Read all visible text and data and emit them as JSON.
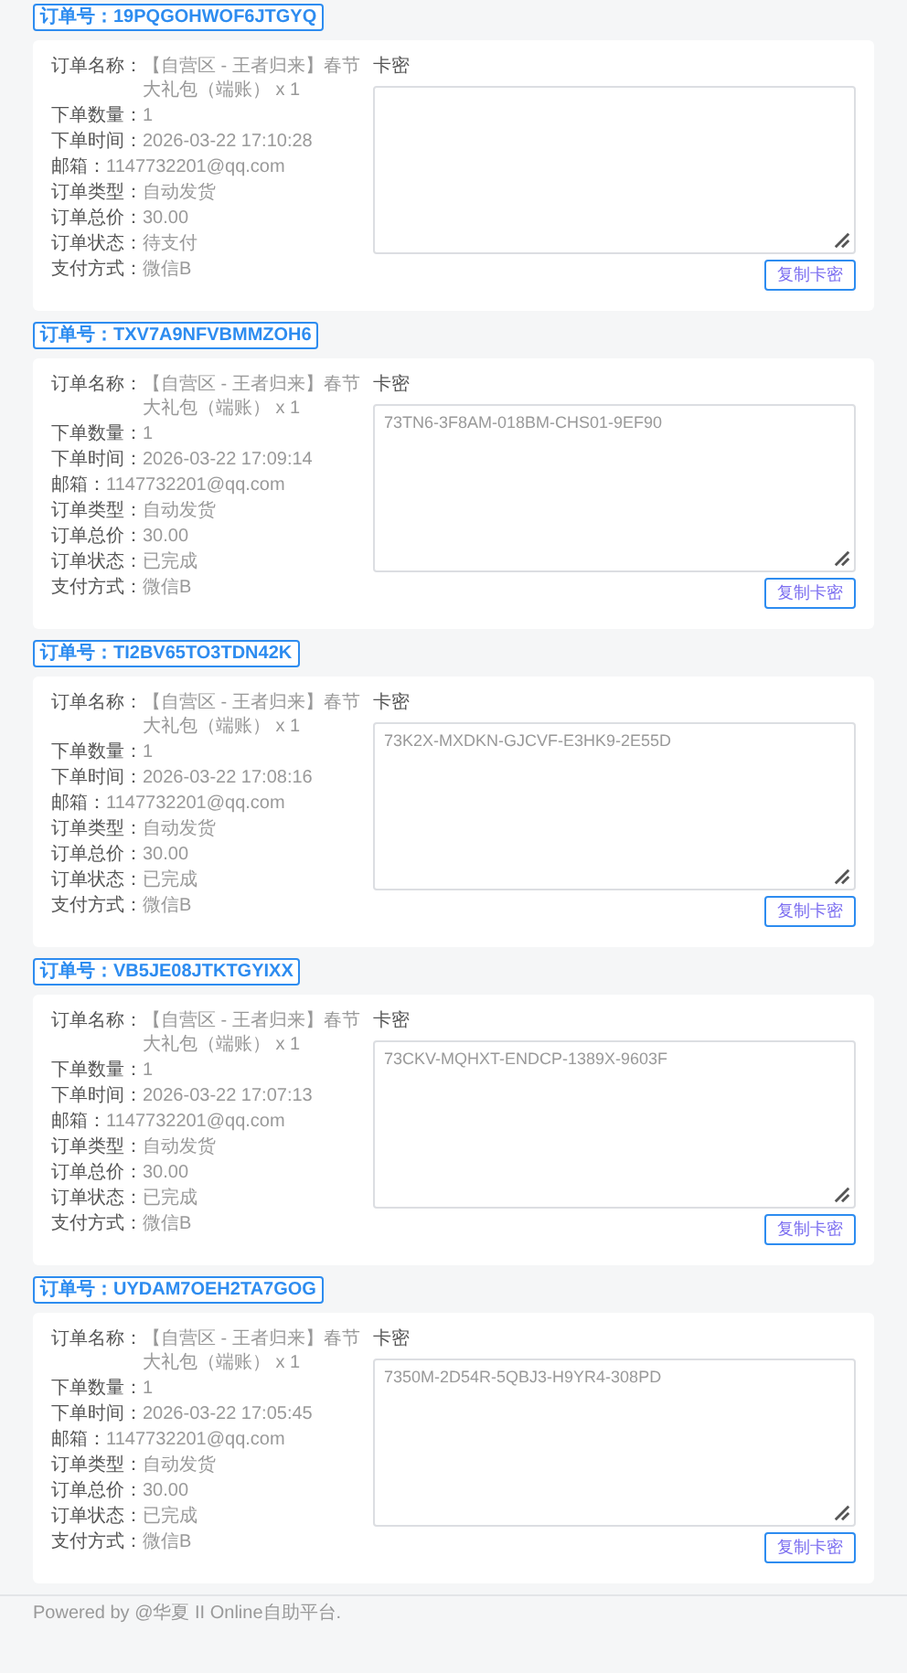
{
  "orders": [
    {
      "order_no_label": "订单号：",
      "order_no": "19PQGOHWOF6JTGYQ",
      "fields": [
        {
          "label": "订单名称：",
          "value": "【自营区 - 王者归来】春节大礼包（端账） x 1"
        },
        {
          "label": "下单数量：",
          "value": "1"
        },
        {
          "label": "下单时间：",
          "value": "2026-03-22 17:10:28"
        },
        {
          "label": "邮箱：",
          "value": "1147732201@qq.com"
        },
        {
          "label": "订单类型：",
          "value": "自动发货"
        },
        {
          "label": "订单总价：",
          "value": "30.00"
        },
        {
          "label": "订单状态：",
          "value": "待支付"
        },
        {
          "label": "支付方式：",
          "value": "微信B"
        }
      ],
      "card_label": "卡密",
      "copy_button": "复制卡密"
    },
    {
      "order_no_label": "订单号：",
      "order_no": "TXV7A9NFVBMMZOH6",
      "fields": [
        {
          "label": "订单名称：",
          "value": "【自营区 - 王者归来】春节大礼包（端账） x 1"
        },
        {
          "label": "下单数量：",
          "value": "1"
        },
        {
          "label": "下单时间：",
          "value": "2026-03-22 17:09:14"
        },
        {
          "label": "邮箱：",
          "value": "1147732201@qq.com"
        },
        {
          "label": "订单类型：",
          "value": "自动发货"
        },
        {
          "label": "订单总价：",
          "value": "30.00"
        },
        {
          "label": "订单状态：",
          "value": "已完成"
        },
        {
          "label": "支付方式：",
          "value": "微信B"
        }
      ],
      "card_label": "卡密",
      "card_code": "73TN6-3F8AM-018BM-CHS01-9EF90",
      "copy_button": "复制卡密"
    },
    {
      "order_no_label": "订单号：",
      "order_no": "TI2BV65TO3TDN42K",
      "fields": [
        {
          "label": "订单名称：",
          "value": "【自营区 - 王者归来】春节大礼包（端账） x 1"
        },
        {
          "label": "下单数量：",
          "value": "1"
        },
        {
          "label": "下单时间：",
          "value": "2026-03-22 17:08:16"
        },
        {
          "label": "邮箱：",
          "value": "1147732201@qq.com"
        },
        {
          "label": "订单类型：",
          "value": "自动发货"
        },
        {
          "label": "订单总价：",
          "value": "30.00"
        },
        {
          "label": "订单状态：",
          "value": "已完成"
        },
        {
          "label": "支付方式：",
          "value": "微信B"
        }
      ],
      "card_label": "卡密",
      "card_code": "73K2X-MXDKN-GJCVF-E3HK9-2E55D",
      "copy_button": "复制卡密"
    },
    {
      "order_no_label": "订单号：",
      "order_no": "VB5JE08JTKTGYIXX",
      "fields": [
        {
          "label": "订单名称：",
          "value": "【自营区 - 王者归来】春节大礼包（端账） x 1"
        },
        {
          "label": "下单数量：",
          "value": "1"
        },
        {
          "label": "下单时间：",
          "value": "2026-03-22 17:07:13"
        },
        {
          "label": "邮箱：",
          "value": "1147732201@qq.com"
        },
        {
          "label": "订单类型：",
          "value": "自动发货"
        },
        {
          "label": "订单总价：",
          "value": "30.00"
        },
        {
          "label": "订单状态：",
          "value": "已完成"
        },
        {
          "label": "支付方式：",
          "value": "微信B"
        }
      ],
      "card_label": "卡密",
      "card_code": "73CKV-MQHXT-ENDCP-1389X-9603F",
      "copy_button": "复制卡密"
    },
    {
      "order_no_label": "订单号：",
      "order_no": "UYDAM7OEH2TA7GOG",
      "fields": [
        {
          "label": "订单名称：",
          "value": "【自营区 - 王者归来】春节大礼包（端账） x 1"
        },
        {
          "label": "下单数量：",
          "value": "1"
        },
        {
          "label": "下单时间：",
          "value": "2026-03-22 17:05:45"
        },
        {
          "label": "邮箱：",
          "value": "1147732201@qq.com"
        },
        {
          "label": "订单类型：",
          "value": "自动发货"
        },
        {
          "label": "订单总价：",
          "value": "30.00"
        },
        {
          "label": "订单状态：",
          "value": "已完成"
        },
        {
          "label": "支付方式：",
          "value": "微信B"
        }
      ],
      "card_label": "卡密",
      "card_code": "7350M-2D54R-5QBJ3-H9YR4-308PD",
      "copy_button": "复制卡密"
    }
  ],
  "footer": "Powered by @华夏 II Online自助平台."
}
